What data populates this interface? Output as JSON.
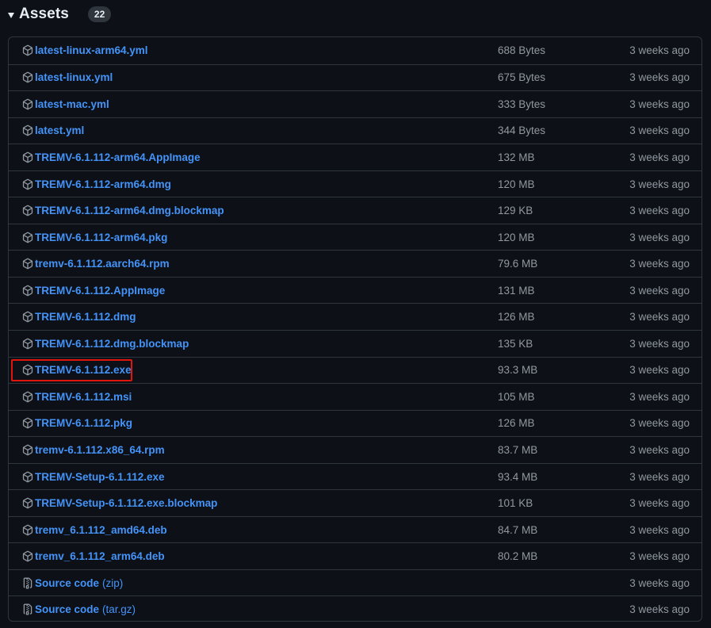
{
  "header": {
    "title": "Assets",
    "count": "22"
  },
  "colors": {
    "link": "#4493f8",
    "muted": "#9198a1",
    "border": "#30363d",
    "background": "#0d1117",
    "highlight": "#e0160e"
  },
  "assets": [
    {
      "icon": "package-icon",
      "name": "latest-linux-arm64.yml",
      "size": "688 Bytes",
      "date": "3 weeks ago"
    },
    {
      "icon": "package-icon",
      "name": "latest-linux.yml",
      "size": "675 Bytes",
      "date": "3 weeks ago"
    },
    {
      "icon": "package-icon",
      "name": "latest-mac.yml",
      "size": "333 Bytes",
      "date": "3 weeks ago"
    },
    {
      "icon": "package-icon",
      "name": "latest.yml",
      "size": "344 Bytes",
      "date": "3 weeks ago"
    },
    {
      "icon": "package-icon",
      "name": "TREMV-6.1.112-arm64.AppImage",
      "size": "132 MB",
      "date": "3 weeks ago"
    },
    {
      "icon": "package-icon",
      "name": "TREMV-6.1.112-arm64.dmg",
      "size": "120 MB",
      "date": "3 weeks ago"
    },
    {
      "icon": "package-icon",
      "name": "TREMV-6.1.112-arm64.dmg.blockmap",
      "size": "129 KB",
      "date": "3 weeks ago"
    },
    {
      "icon": "package-icon",
      "name": "TREMV-6.1.112-arm64.pkg",
      "size": "120 MB",
      "date": "3 weeks ago"
    },
    {
      "icon": "package-icon",
      "name": "tremv-6.1.112.aarch64.rpm",
      "size": "79.6 MB",
      "date": "3 weeks ago"
    },
    {
      "icon": "package-icon",
      "name": "TREMV-6.1.112.AppImage",
      "size": "131 MB",
      "date": "3 weeks ago"
    },
    {
      "icon": "package-icon",
      "name": "TREMV-6.1.112.dmg",
      "size": "126 MB",
      "date": "3 weeks ago"
    },
    {
      "icon": "package-icon",
      "name": "TREMV-6.1.112.dmg.blockmap",
      "size": "135 KB",
      "date": "3 weeks ago"
    },
    {
      "icon": "package-icon",
      "name": "TREMV-6.1.112.exe",
      "size": "93.3 MB",
      "date": "3 weeks ago",
      "highlighted": true
    },
    {
      "icon": "package-icon",
      "name": "TREMV-6.1.112.msi",
      "size": "105 MB",
      "date": "3 weeks ago"
    },
    {
      "icon": "package-icon",
      "name": "TREMV-6.1.112.pkg",
      "size": "126 MB",
      "date": "3 weeks ago"
    },
    {
      "icon": "package-icon",
      "name": "tremv-6.1.112.x86_64.rpm",
      "size": "83.7 MB",
      "date": "3 weeks ago"
    },
    {
      "icon": "package-icon",
      "name": "TREMV-Setup-6.1.112.exe",
      "size": "93.4 MB",
      "date": "3 weeks ago"
    },
    {
      "icon": "package-icon",
      "name": "TREMV-Setup-6.1.112.exe.blockmap",
      "size": "101 KB",
      "date": "3 weeks ago"
    },
    {
      "icon": "package-icon",
      "name": "tremv_6.1.112_amd64.deb",
      "size": "84.7 MB",
      "date": "3 weeks ago"
    },
    {
      "icon": "package-icon",
      "name": "tremv_6.1.112_arm64.deb",
      "size": "80.2 MB",
      "date": "3 weeks ago"
    },
    {
      "icon": "file-zip-icon",
      "name": "Source code",
      "suffix": "(zip)",
      "size": "",
      "date": "3 weeks ago"
    },
    {
      "icon": "file-zip-icon",
      "name": "Source code",
      "suffix": "(tar.gz)",
      "size": "",
      "date": "3 weeks ago"
    }
  ]
}
